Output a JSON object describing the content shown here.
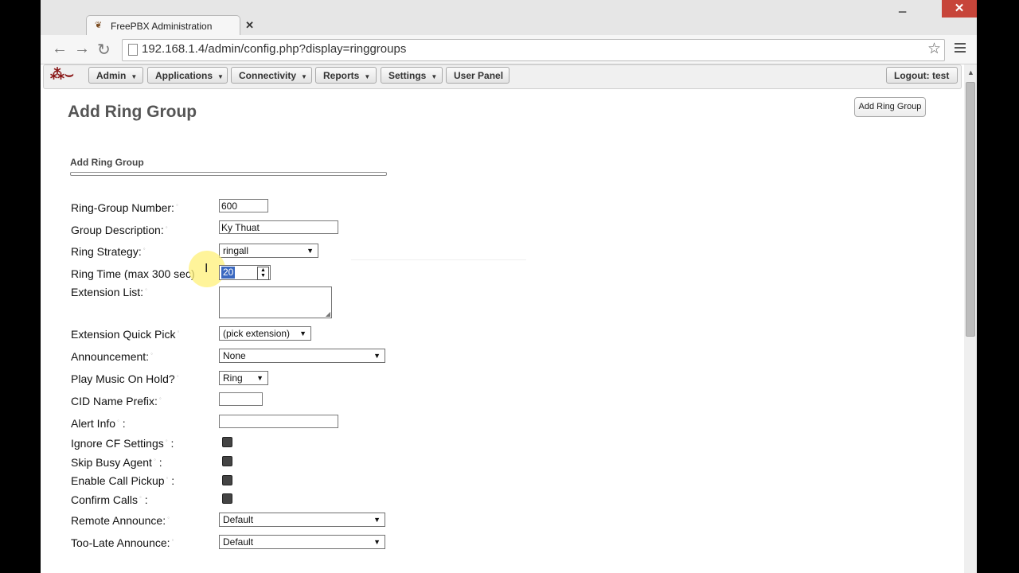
{
  "browser": {
    "tab_title": "FreePBX Administration",
    "tab_close": "✕",
    "window_close": "✕",
    "url": "192.168.1.4/admin/config.php?display=ringgroups"
  },
  "menu": {
    "items": [
      {
        "label": "Admin",
        "has_caret": true
      },
      {
        "label": "Applications",
        "has_caret": true
      },
      {
        "label": "Connectivity",
        "has_caret": true
      },
      {
        "label": "Reports",
        "has_caret": true
      },
      {
        "label": "Settings",
        "has_caret": true
      },
      {
        "label": "User Panel",
        "has_caret": false
      }
    ],
    "logout": "Logout: test"
  },
  "page": {
    "title": "Add Ring Group",
    "add_button": "Add Ring Group",
    "section": "Add Ring Group"
  },
  "form": {
    "ring_group_number": {
      "label": "Ring-Group Number:",
      "value": "600"
    },
    "group_description": {
      "label": "Group Description:",
      "value": "Ky Thuat"
    },
    "ring_strategy": {
      "label": "Ring Strategy:",
      "value": "ringall"
    },
    "ring_time": {
      "label": "Ring Time (max 300 sec)",
      "value": "20"
    },
    "extension_list": {
      "label": "Extension List:",
      "value": ""
    },
    "extension_quick_pick": {
      "label": "Extension Quick Pick",
      "value": "(pick extension)"
    },
    "announcement": {
      "label": "Announcement:",
      "value": "None"
    },
    "play_moh": {
      "label": "Play Music On Hold?",
      "value": "Ring"
    },
    "cid_name_prefix": {
      "label": "CID Name Prefix:",
      "value": ""
    },
    "alert_info": {
      "label": "Alert Info",
      "suffix": ":",
      "value": ""
    },
    "ignore_cf": {
      "label": "Ignore CF Settings",
      "suffix": ":",
      "checked": true
    },
    "skip_busy": {
      "label": "Skip Busy Agent",
      "suffix": ":",
      "checked": true
    },
    "call_pickup": {
      "label": "Enable Call Pickup",
      "suffix": ":",
      "checked": true
    },
    "confirm_calls": {
      "label": "Confirm Calls",
      "suffix": ":",
      "checked": true
    },
    "remote_announce": {
      "label": "Remote Announce:",
      "value": "Default"
    },
    "too_late_announce": {
      "label": "Too-Late Announce:",
      "value": "Default"
    }
  },
  "colors": {
    "window_close_red": "#c7453a",
    "selection_blue": "#3a68c0",
    "cursor_highlight": "#fff078"
  }
}
